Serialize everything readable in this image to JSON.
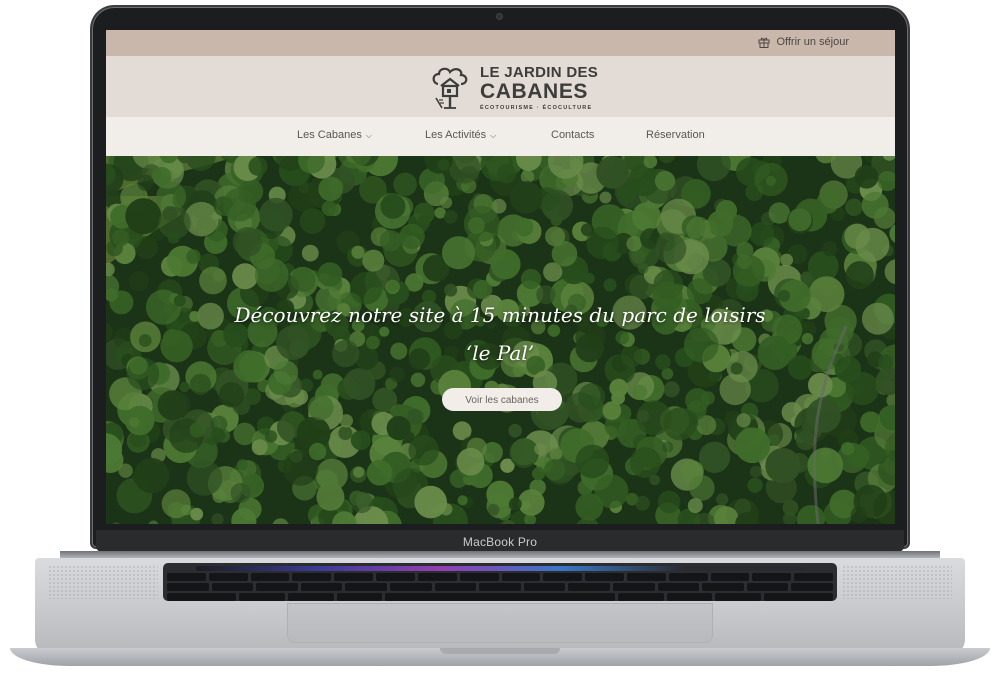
{
  "device": {
    "model_label": "MacBook Pro"
  },
  "topbar": {
    "gift_label": "Offrir un séjour",
    "background": "#c9b7ab"
  },
  "logo": {
    "line1": "LE JARDIN DES",
    "line2": "CABANES",
    "tagline": "ÉCOTOURISME · ÉCOCULTURE"
  },
  "nav": {
    "items": [
      {
        "label": "Les Cabanes",
        "has_dropdown": true
      },
      {
        "label": "Les Activités",
        "has_dropdown": true
      },
      {
        "label": "Contacts",
        "has_dropdown": false
      },
      {
        "label": "Réservation",
        "has_dropdown": false
      }
    ]
  },
  "hero": {
    "title_line1": "Découvrez notre site à 15 minutes du parc de loisirs",
    "title_line2": "‘le Pal’",
    "button_label": "Voir les cabanes"
  },
  "colors": {
    "header_bg": "#e2dbd6",
    "nav_bg": "#f1ede9",
    "text_dark": "#3d3d3b"
  }
}
